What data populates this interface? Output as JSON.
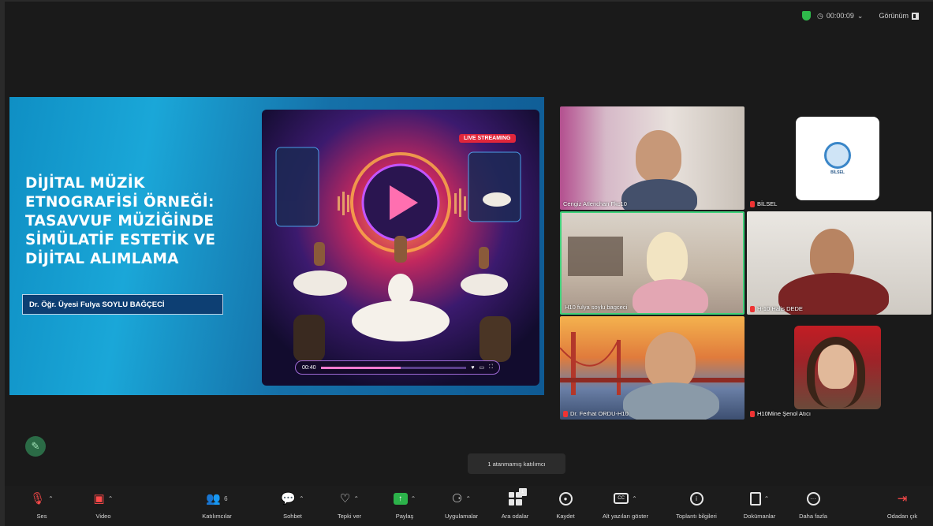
{
  "topbar": {
    "timer": "00:00:09",
    "timer_caret": "⌄",
    "view_label": "Görünüm"
  },
  "slide": {
    "title_lines": [
      "DİJİTAL MÜZİK",
      "ETNOGRAFİSİ ÖRNEĞİ:",
      "TASAVVUF MÜZİĞİNDE",
      "SİMÜLATİF ESTETİK VE",
      "DİJİTAL ALIMLAMA"
    ],
    "author": "Dr. Öğr. Üyesi Fulya SOYLU BAĞÇECİ",
    "live_badge": "LIVE STREAMING",
    "player_time": "00:40",
    "player_progress": 0.55
  },
  "participants": [
    {
      "name": "Cengiz Atlenchan Fkc10"
    },
    {
      "name": "BİLSEL",
      "logo_text": "BİLSEL"
    },
    {
      "name": "H10 fulya soylu bagceci"
    },
    {
      "name": "H-10 Halis DEDE"
    },
    {
      "name": "Dr. Ferhat ORDU-H10"
    },
    {
      "name": "H10Mine Şenol Atıcı"
    }
  ],
  "tooltip": "1 atanmamış katılımcı",
  "toolbar": {
    "items": [
      {
        "label": "Ses"
      },
      {
        "label": "Video"
      },
      {
        "label": "Katılımcılar",
        "count": "6"
      },
      {
        "label": "Sohbet"
      },
      {
        "label": "Tepki ver"
      },
      {
        "label": "Paylaş"
      },
      {
        "label": "Uygulamalar"
      },
      {
        "label": "Ara odalar",
        "badge": "1"
      },
      {
        "label": "Kaydet"
      },
      {
        "label": "Alt yazıları göster"
      },
      {
        "label": "Toplantı bilgileri"
      },
      {
        "label": "Dokümanlar"
      },
      {
        "label": "Daha fazla"
      },
      {
        "label": "Odadan çık"
      }
    ]
  },
  "colors": {
    "accent_green": "#2fb84b",
    "slide_blue": "#1570a8",
    "active_speaker": "#3fd17a",
    "muted_red": "#e33333"
  }
}
